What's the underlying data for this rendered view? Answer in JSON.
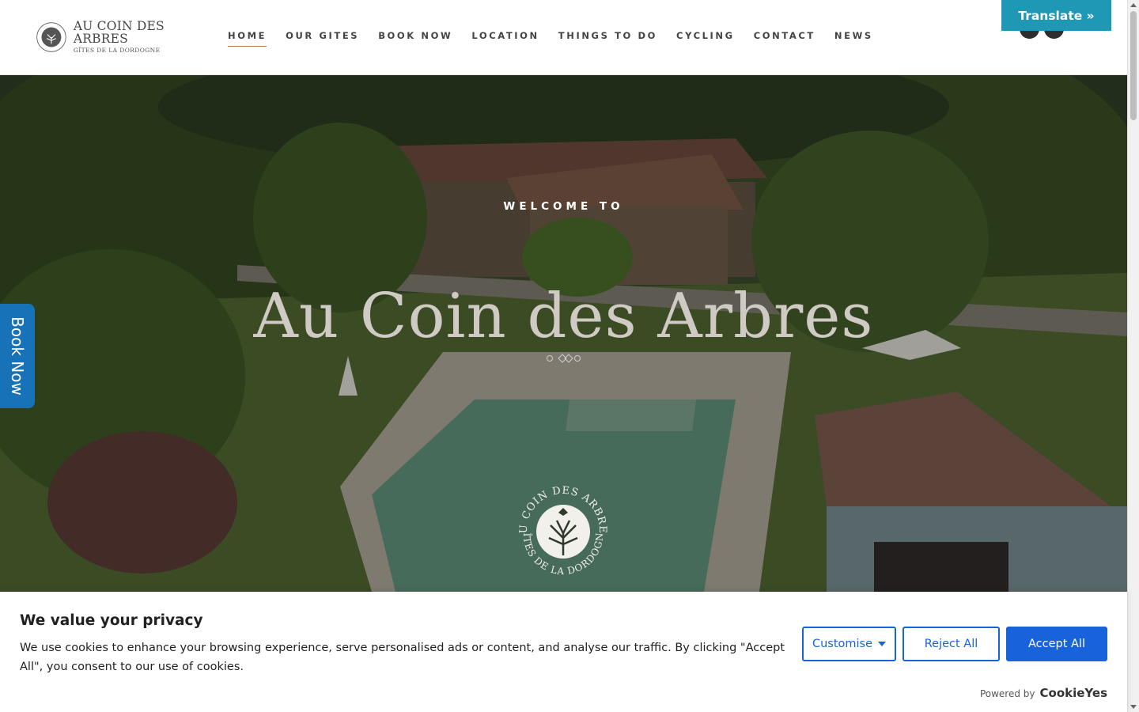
{
  "site": {
    "logo": {
      "title": "AU COIN DES ARBRES",
      "subtitle": "GÎTES DE LA DORDOGNE",
      "icon": "tree-logo-icon"
    }
  },
  "nav": {
    "items": [
      {
        "label": "HOME",
        "active": true
      },
      {
        "label": "OUR GITES"
      },
      {
        "label": "BOOK NOW"
      },
      {
        "label": "LOCATION"
      },
      {
        "label": "THINGS TO DO"
      },
      {
        "label": "CYCLING"
      },
      {
        "label": "CONTACT"
      },
      {
        "label": "NEWS"
      }
    ]
  },
  "social": [
    {
      "icon": "facebook-icon"
    },
    {
      "icon": "instagram-icon"
    }
  ],
  "translate": {
    "label": "Translate »",
    "color": "#1e98b4"
  },
  "hero": {
    "welcome": "WELCOME TO",
    "title": "Au Coin des Arbres",
    "seal_top_text": "AU COIN DES ARBRES",
    "seal_bottom_text": "GÎTES DE LA DORDOGNE"
  },
  "book_tab": {
    "label": "Book Now",
    "color": "#1872b8"
  },
  "cookie": {
    "title": "We value your privacy",
    "text": "We use cookies to enhance your browsing experience, serve personalised ads or content, and analyse our traffic. By clicking \"Accept All\", you consent to our use of cookies.",
    "customise_label": "Customise",
    "reject_label": "Reject All",
    "accept_label": "Accept All",
    "powered_by": "Powered by",
    "brand": "CookieYes",
    "accent": "#1863dc"
  }
}
